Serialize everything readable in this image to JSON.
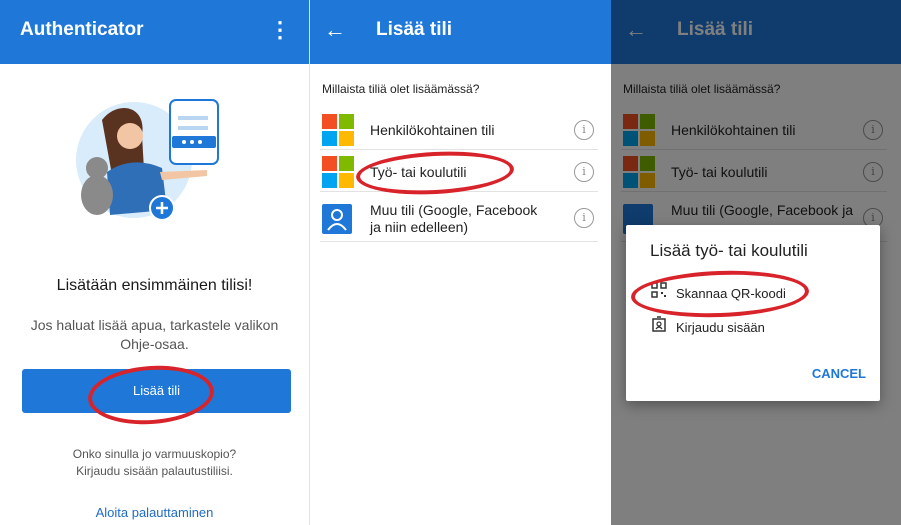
{
  "screen1": {
    "app_title": "Authenticator",
    "more_icon": "⋮",
    "heading": "Lisätään ensimmäinen tilisi!",
    "subtext": "Jos haluat lisää apua, tarkastele valikon Ohje-osaa.",
    "add_button": "Lisää tili",
    "backup_text": "Onko sinulla jo varmuuskopio? Kirjaudu sisään palautustiliisi.",
    "restore_link": "Aloita palauttaminen"
  },
  "screen2": {
    "title": "Lisää tili",
    "back_icon": "←",
    "question": "Millaista tiliä olet lisäämässä?",
    "options": [
      {
        "label": "Henkilökohtainen tili",
        "icon": "microsoft-logo-icon"
      },
      {
        "label": "Työ- tai koulutili",
        "icon": "microsoft-logo-icon"
      },
      {
        "label": "Muu tili (Google, Facebook ja niin edelleen)",
        "icon": "person-icon"
      }
    ],
    "info_icon": "i"
  },
  "screen3": {
    "title": "Lisää tili",
    "back_icon": "←",
    "question": "Millaista tiliä olet lisäämässä?",
    "options": [
      {
        "label": "Henkilökohtainen tili"
      },
      {
        "label": "Työ- tai koulutili"
      },
      {
        "label": "Muu tili (Google, Facebook ja"
      }
    ],
    "dialog": {
      "title": "Lisää työ- tai koulutili",
      "scan_label": "Skannaa QR-koodi",
      "signin_label": "Kirjaudu sisään",
      "cancel_label": "CANCEL"
    }
  },
  "colors": {
    "accent": "#1f78d8",
    "annotation": "#d8232a"
  }
}
